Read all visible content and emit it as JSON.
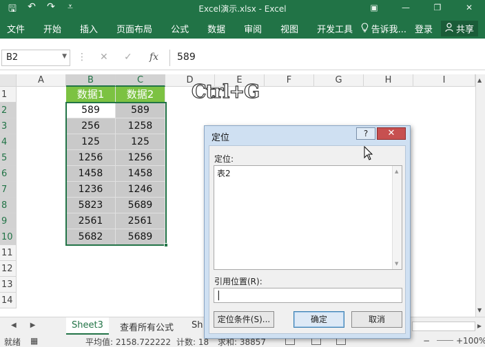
{
  "window": {
    "title": "Excel演示.xlsx - Excel",
    "controls": [
      "▣",
      "—",
      "❐",
      "✕"
    ]
  },
  "qat": {
    "icons": [
      "save-icon",
      "undo-icon",
      "redo-icon",
      "customize-icon"
    ],
    "glyphs": [
      "🖫",
      "↶",
      "↷",
      "⩡"
    ]
  },
  "ribbon": {
    "tabs": [
      "文件",
      "开始",
      "插入",
      "页面布局",
      "公式",
      "数据",
      "审阅",
      "视图",
      "开发工具"
    ],
    "tellme": "告诉我...",
    "login": "登录",
    "share": "共享"
  },
  "formula_bar": {
    "name_box": "B2",
    "cancel": "✕",
    "enter": "✓",
    "fx": "fx",
    "value": "589"
  },
  "grid": {
    "columns": [
      "A",
      "B",
      "C",
      "D",
      "E",
      "F",
      "G",
      "H",
      "I"
    ],
    "rows": [
      "1",
      "2",
      "3",
      "4",
      "5",
      "6",
      "7",
      "8",
      "9",
      "10",
      "11",
      "12",
      "13",
      "14"
    ],
    "headers": [
      "数据1",
      "数据2"
    ],
    "data": [
      [
        "589",
        "589"
      ],
      [
        "256",
        "1258"
      ],
      [
        "125",
        "125"
      ],
      [
        "1256",
        "1256"
      ],
      [
        "1458",
        "1458"
      ],
      [
        "1236",
        "1246"
      ],
      [
        "5823",
        "5689"
      ],
      [
        "2561",
        "2561"
      ],
      [
        "5682",
        "5689"
      ]
    ]
  },
  "overlay_text": "Ctrl+G",
  "sheets": {
    "tabs": [
      "Sheet3",
      "查看所有公式",
      "Sh"
    ],
    "active": "Sheet3"
  },
  "status": {
    "ready": "就绪",
    "average": "平均值: 2158.722222",
    "count": "计数: 18",
    "sum": "求和: 38857",
    "zoom": "100%"
  },
  "dialog": {
    "title": "定位",
    "help": "?",
    "close": "✕",
    "goto_label": "定位:",
    "list_items": [
      "表2"
    ],
    "reference_label": "引用位置(R):",
    "reference_value": "|",
    "special_button": "定位条件(S)...",
    "ok_button": "确定",
    "cancel_button": "取消"
  }
}
